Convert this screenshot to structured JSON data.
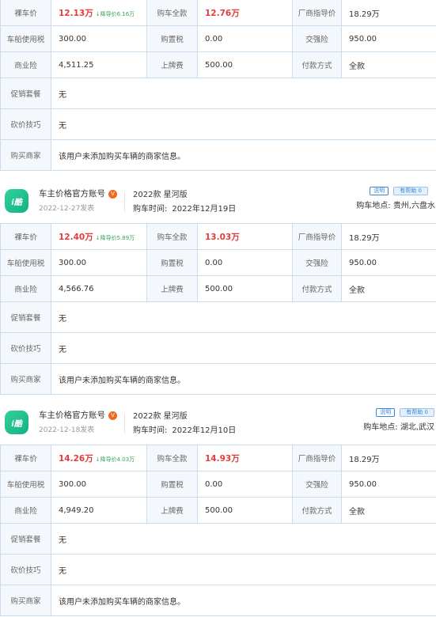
{
  "labels": {
    "naked_price": "裸车价",
    "full_price": "购车全款",
    "guide_price": "厂商指导价",
    "vehicle_tax": "车船使用税",
    "purchase_tax": "购置税",
    "compulsory_ins": "交强险",
    "commercial_ins": "商业险",
    "plate_fee": "上牌费",
    "payment": "付款方式",
    "promo": "促销套餐",
    "bargain": "砍价技巧",
    "dealer": "购买商家"
  },
  "help_label": "有帮助",
  "explain_label": "说明",
  "location_prefix": "购车地点:",
  "purchase_time_prefix": "购车时间:",
  "posts": [
    {
      "user": null,
      "table": {
        "naked_price": "12.13万",
        "discount": "降导价6.16万",
        "full_price": "12.76万",
        "guide_price": "18.29万",
        "vehicle_tax": "300.00",
        "purchase_tax": "0.00",
        "compulsory_ins": "950.00",
        "commercial_ins": "4,511.25",
        "plate_fee": "500.00",
        "payment": "全款",
        "promo": "无",
        "bargain": "无",
        "dealer": "该用户未添加购买车辆的商家信息。"
      }
    },
    {
      "user": {
        "avatar_text": "i酷",
        "name": "车主价格官方账号",
        "vip": "V",
        "post_date": "2022-12-27发表",
        "model": "2022款 星河版",
        "purchase_date": "2022年12月19日",
        "help_count": "0",
        "location": "贵州,六盘水"
      },
      "table": {
        "naked_price": "12.40万",
        "discount": "降导价5.89万",
        "full_price": "13.03万",
        "guide_price": "18.29万",
        "vehicle_tax": "300.00",
        "purchase_tax": "0.00",
        "compulsory_ins": "950.00",
        "commercial_ins": "4,566.76",
        "plate_fee": "500.00",
        "payment": "全款",
        "promo": "无",
        "bargain": "无",
        "dealer": "该用户未添加购买车辆的商家信息。"
      }
    },
    {
      "user": {
        "avatar_text": "i酷",
        "name": "车主价格官方账号",
        "vip": "V",
        "post_date": "2022-12-18发表",
        "model": "2022款 星河版",
        "purchase_date": "2022年12月10日",
        "help_count": "0",
        "location": "湖北,武汉"
      },
      "table": {
        "naked_price": "14.26万",
        "discount": "降导价4.03万",
        "full_price": "14.93万",
        "guide_price": "18.29万",
        "vehicle_tax": "300.00",
        "purchase_tax": "0.00",
        "compulsory_ins": "950.00",
        "commercial_ins": "4,949.20",
        "plate_fee": "500.00",
        "payment": "全款",
        "promo": "无",
        "bargain": "无",
        "dealer": "该用户未添加购买车辆的商家信息。"
      }
    }
  ]
}
